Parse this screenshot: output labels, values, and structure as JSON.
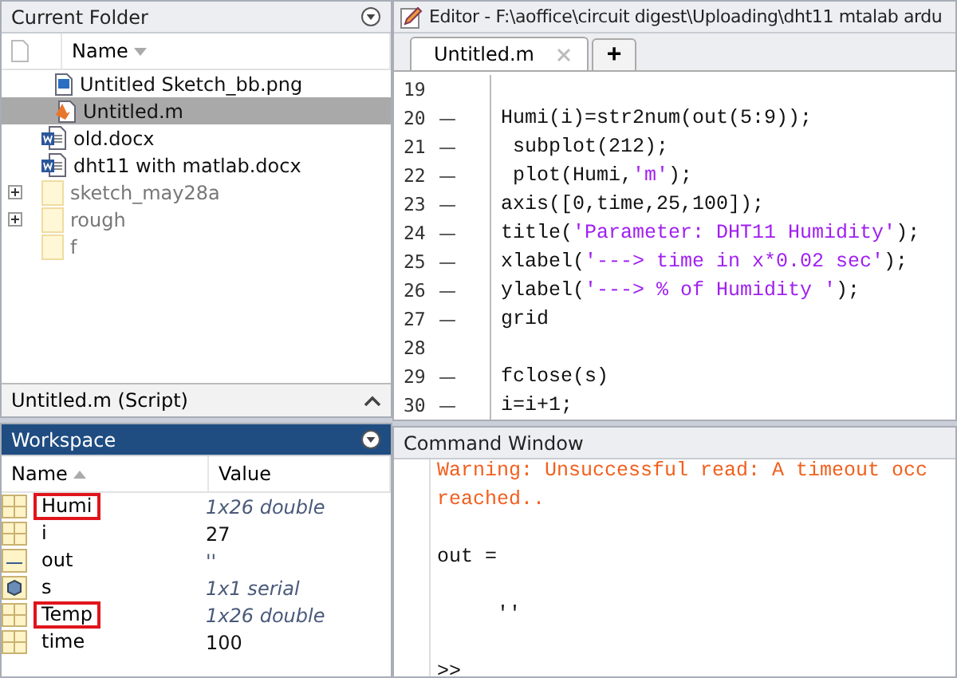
{
  "current_folder": {
    "title": "Current Folder",
    "column": "Name",
    "items": [
      {
        "name": "Untitled Sketch_bb.png",
        "kind": "image",
        "selected": false,
        "expandable": false
      },
      {
        "name": "Untitled.m",
        "kind": "script",
        "selected": true,
        "expandable": false
      },
      {
        "name": "old.docx",
        "kind": "doc",
        "selected": false,
        "expandable": false
      },
      {
        "name": "dht11 with matlab.docx",
        "kind": "doc",
        "selected": false,
        "expandable": false
      },
      {
        "name": "sketch_may28a",
        "kind": "folder",
        "selected": false,
        "expandable": true
      },
      {
        "name": "rough",
        "kind": "folder",
        "selected": false,
        "expandable": true
      },
      {
        "name": "f",
        "kind": "folder",
        "selected": false,
        "expandable": false
      }
    ],
    "details": "Untitled.m  (Script)"
  },
  "workspace": {
    "title": "Workspace",
    "columns": [
      "Name",
      "Value"
    ],
    "rows": [
      {
        "name": "Humi",
        "value": "1x26 double",
        "kind": "matrix",
        "highlighted": true
      },
      {
        "name": "i",
        "value": "27",
        "kind": "matrix",
        "highlighted": false
      },
      {
        "name": "out",
        "value": "''",
        "kind": "text",
        "highlighted": false
      },
      {
        "name": "s",
        "value": "1x1 serial",
        "kind": "object",
        "highlighted": false
      },
      {
        "name": "Temp",
        "value": "1x26 double",
        "kind": "matrix",
        "highlighted": true
      },
      {
        "name": "time",
        "value": "100",
        "kind": "matrix",
        "highlighted": false
      }
    ]
  },
  "editor": {
    "title": "Editor - F:\\aoffice\\circuit digest\\Uploading\\dht11 mtalab ardu",
    "tabs": [
      {
        "label": "Untitled.m",
        "selected": true
      }
    ],
    "new_tab": "+",
    "lines": [
      {
        "number": "19"
      },
      {
        "number": "20",
        "marker": "—",
        "code": [
          {
            "text": "Humi(i)=str2num(out(5:9));",
            "kind": "code"
          }
        ]
      },
      {
        "number": "21",
        "marker": "—",
        "code": [
          {
            "text": " subplot(212);",
            "kind": "code"
          }
        ]
      },
      {
        "number": "22",
        "marker": "—",
        "code": [
          {
            "text": " plot(Humi,",
            "kind": "code"
          },
          {
            "text": "'m'",
            "kind": "string"
          },
          {
            "text": ");",
            "kind": "code"
          }
        ]
      },
      {
        "number": "23",
        "marker": "—",
        "code": [
          {
            "text": "axis([0,time,25,100]);",
            "kind": "code"
          }
        ]
      },
      {
        "number": "24",
        "marker": "—",
        "code": [
          {
            "text": "title(",
            "kind": "code"
          },
          {
            "text": "'Parameter: DHT11 Humidity'",
            "kind": "string"
          },
          {
            "text": ");",
            "kind": "code"
          }
        ]
      },
      {
        "number": "25",
        "marker": "—",
        "code": [
          {
            "text": "xlabel(",
            "kind": "code"
          },
          {
            "text": "'---> time in x*0.02 sec'",
            "kind": "string"
          },
          {
            "text": ");",
            "kind": "code"
          }
        ]
      },
      {
        "number": "26",
        "marker": "—",
        "code": [
          {
            "text": "ylabel(",
            "kind": "code"
          },
          {
            "text": "'---> % of Humidity '",
            "kind": "string"
          },
          {
            "text": ");",
            "kind": "code"
          }
        ]
      },
      {
        "number": "27",
        "marker": "—",
        "code": [
          {
            "text": "grid",
            "kind": "code"
          }
        ]
      },
      {
        "number": "28"
      },
      {
        "number": "29",
        "marker": "—",
        "code": [
          {
            "text": "fclose(s)",
            "kind": "code"
          }
        ]
      },
      {
        "number": "30",
        "marker": "—",
        "code": [
          {
            "text": "i=i+1;",
            "kind": "code"
          }
        ]
      }
    ]
  },
  "command_window": {
    "title": "Command Window",
    "lines": [
      {
        "text": "Warning: Unsuccessful read: A timeout occ",
        "kind": "warning"
      },
      {
        "text": "reached..",
        "kind": "warning"
      },
      {
        "kind": "blank"
      },
      {
        "text": "out =",
        "kind": "output"
      },
      {
        "kind": "blank"
      },
      {
        "text": "     ''",
        "kind": "output"
      },
      {
        "kind": "blank"
      },
      {
        "text": ">>",
        "kind": "prompt"
      }
    ]
  }
}
